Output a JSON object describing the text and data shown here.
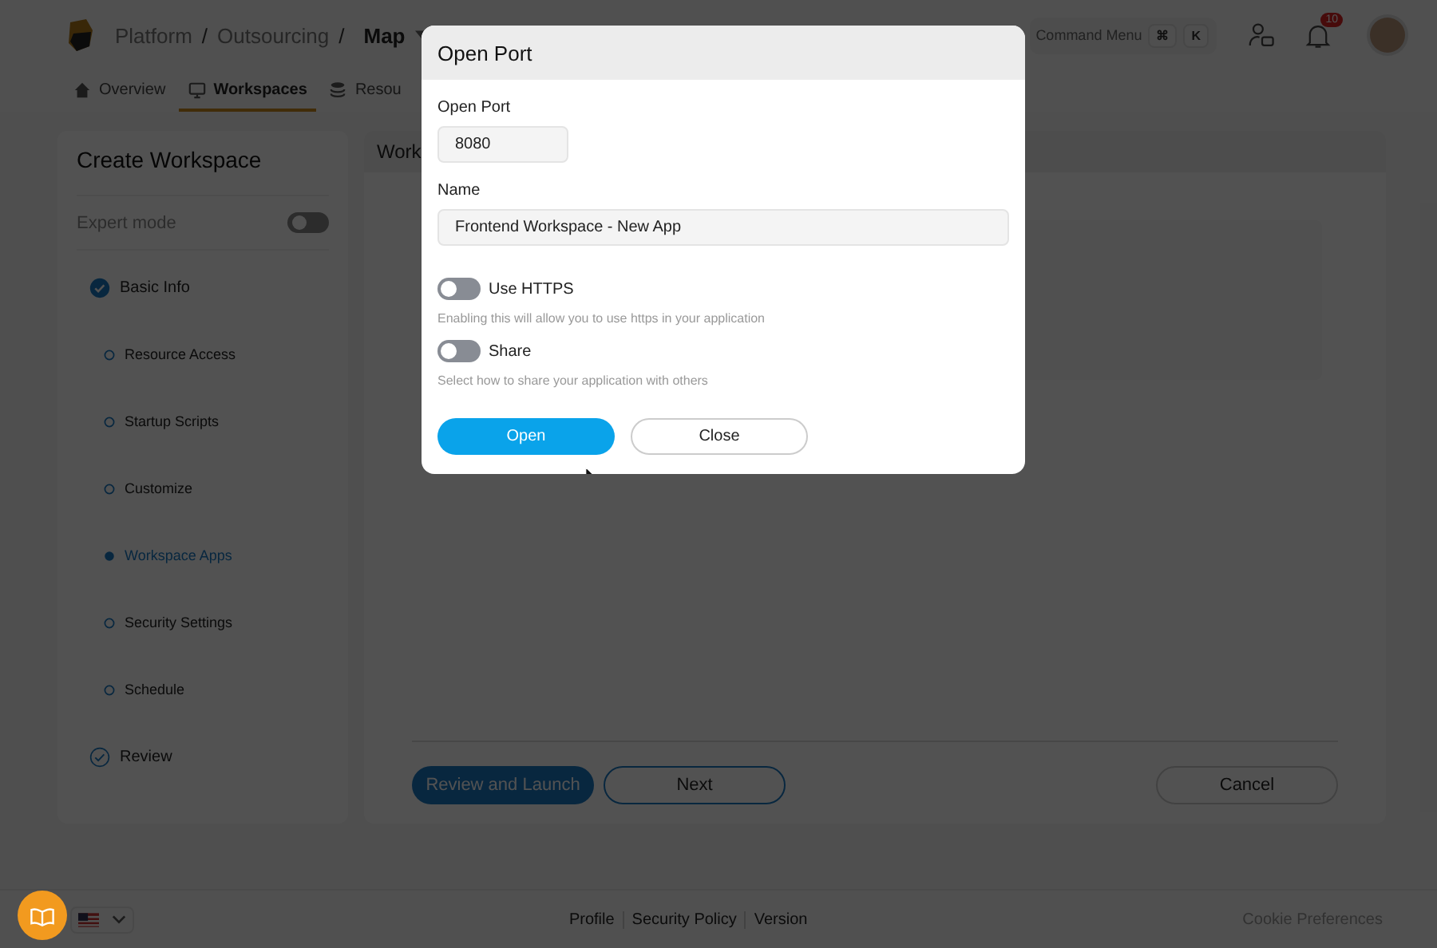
{
  "header": {
    "breadcrumbs": [
      {
        "label": "Platform",
        "separator": "/"
      },
      {
        "label": "Outsourcing",
        "separator": "/"
      }
    ],
    "current": "Map",
    "command_menu": {
      "label": "Command Menu",
      "keys": [
        "⌘",
        "K"
      ]
    },
    "notifications": {
      "count": "10"
    }
  },
  "tabs": [
    {
      "label": "Overview",
      "selected": false
    },
    {
      "label": "Workspaces",
      "selected": true
    },
    {
      "label": "Resou",
      "selected": false
    }
  ],
  "sidebar": {
    "title": "Create Workspace",
    "expert_mode": {
      "label": "Expert mode",
      "on": false
    },
    "steps": [
      {
        "label": "Basic Info",
        "kind": "step",
        "completed": true,
        "current": false
      },
      {
        "label": "Resource Access",
        "kind": "substep",
        "completed": false,
        "current": false
      },
      {
        "label": "Startup Scripts",
        "kind": "substep",
        "completed": false,
        "current": false
      },
      {
        "label": "Customize",
        "kind": "substep",
        "completed": false,
        "current": false
      },
      {
        "label": "Workspace Apps",
        "kind": "substep",
        "completed": false,
        "current": true
      },
      {
        "label": "Security Settings",
        "kind": "substep",
        "completed": false,
        "current": false
      },
      {
        "label": "Schedule",
        "kind": "substep",
        "completed": false,
        "current": false
      },
      {
        "label": "Review",
        "kind": "step",
        "completed": false,
        "current": false
      }
    ]
  },
  "main": {
    "title": "Work",
    "buttons": [
      {
        "label": "Review and Launch",
        "kind": "primary"
      },
      {
        "label": "Next",
        "kind": "outline"
      },
      {
        "label": "Cancel",
        "kind": "secondary"
      }
    ]
  },
  "dialog": {
    "title": "Open Port",
    "port": {
      "label": "Open Port",
      "value": "8080"
    },
    "name": {
      "label": "Name",
      "value": "Frontend Workspace - New App"
    },
    "toggles": [
      {
        "label": "Use HTTPS",
        "on": false,
        "hint": "Enabling this will allow you to use https in your application"
      },
      {
        "label": "Share",
        "on": false,
        "hint": "Select how to share your application with others"
      }
    ],
    "buttons": [
      {
        "label": "Open",
        "kind": "primary"
      },
      {
        "label": "Close",
        "kind": "secondary"
      }
    ]
  },
  "footer": {
    "links": [
      "Profile",
      "Security Policy",
      "Version"
    ],
    "cookie": "Cookie Preferences"
  }
}
